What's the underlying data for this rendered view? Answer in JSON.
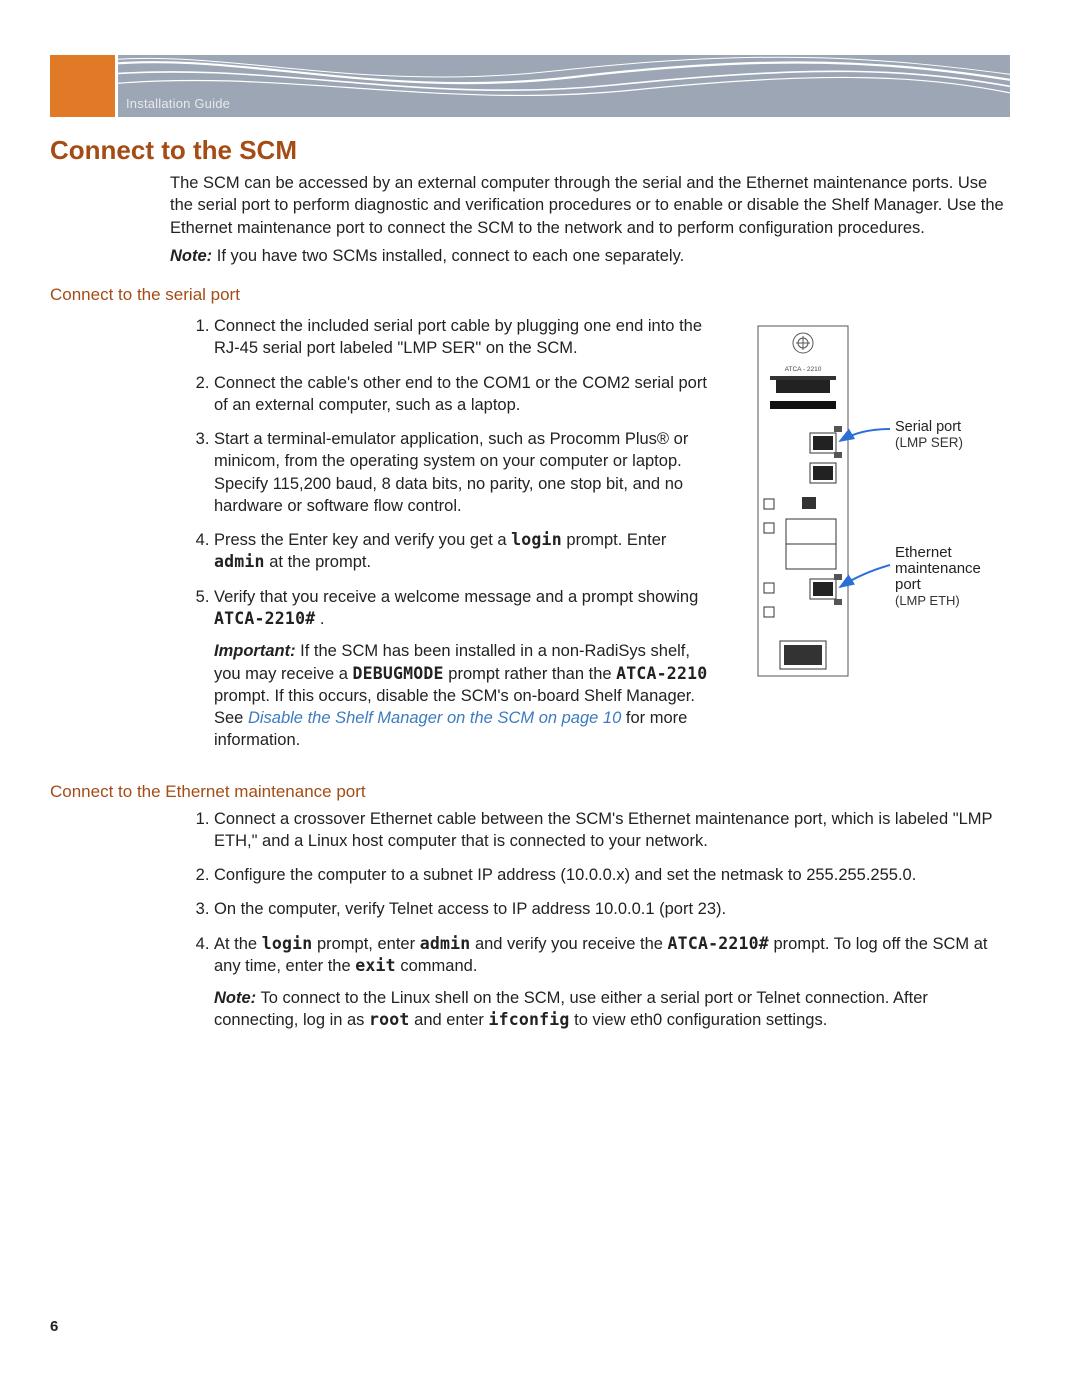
{
  "header": {
    "guide_label": "Installation Guide"
  },
  "page_number": "6",
  "section": {
    "title": "Connect to the SCM",
    "intro": "The SCM can be accessed by an external computer through the serial and the Ethernet maintenance ports. Use the serial port to perform diagnostic and verification procedures or to enable or disable the Shelf Manager. Use the Ethernet maintenance port to connect the SCM to the network and to perform configuration procedures.",
    "note_label": "Note:",
    "note_text": " If you have two SCMs installed, connect to each one separately."
  },
  "serial": {
    "title": "Connect to the serial port",
    "steps": {
      "s1": "Connect the included serial port cable by plugging one end into the RJ-45 serial port labeled \"LMP SER\" on the SCM.",
      "s2": "Connect the cable's other end to the COM1 or the COM2 serial port of an external computer, such as a laptop.",
      "s3": "Start a terminal-emulator application, such as Procomm Plus® or minicom, from the operating system on your computer or laptop. Specify 115,200 baud, 8 data bits, no parity, one stop bit, and no hardware or software flow control.",
      "s4_a": "Press the Enter key and verify you get a ",
      "s4_b": "login",
      "s4_c": " prompt. Enter ",
      "s4_d": "admin",
      "s4_e": " at the prompt.",
      "s5_a": "Verify that you receive a welcome message and a prompt showing ",
      "s5_b": "ATCA-2210#",
      "s5_c": " .",
      "imp_label": "Important:",
      "imp_a": " If the SCM has been installed in a non-RadiSys shelf, you may receive a ",
      "imp_b": "DEBUGMODE",
      "imp_b2": " prompt rather than the ",
      "imp_c": "ATCA-2210",
      "imp_d": " prompt. If this occurs, disable the SCM's on-board Shelf Manager. See ",
      "imp_link": "Disable the Shelf Manager on the SCM",
      "imp_link2": " on page 10",
      "imp_e": " for more information."
    },
    "diagram": {
      "board_label": "ATCA - 2210",
      "serial_label": "Serial port",
      "serial_sub": "(LMP SER)",
      "eth_label": "Ethernet maintenance port",
      "eth_sub": "(LMP ETH)"
    }
  },
  "ethernet": {
    "title": "Connect to the Ethernet maintenance port",
    "steps": {
      "s1": "Connect a crossover Ethernet cable between the SCM's Ethernet maintenance port, which is labeled \"LMP ETH,\" and a Linux host computer that is connected to your network.",
      "s2": "Configure the computer to a subnet IP address (10.0.0.x) and set the netmask to 255.255.255.0.",
      "s3": "On the computer, verify Telnet access to IP address 10.0.0.1 (port 23).",
      "s4_a": "At the ",
      "s4_b": "login",
      "s4_c": " prompt, enter ",
      "s4_d": "admin",
      "s4_e": " and verify you receive the ",
      "s4_f": "ATCA-2210#",
      "s4_g": " prompt. To log off the SCM at any time, enter  the ",
      "s4_h": "exit",
      "s4_i": " command.",
      "note_label": "Note:",
      "note_a": " To connect to the Linux shell on the SCM, use either a serial port or Telnet connection. After connecting, log in as ",
      "note_b": "root",
      "note_c": " and enter ",
      "note_d": "ifconfig",
      "note_e": " to view eth0 configuration settings."
    }
  }
}
